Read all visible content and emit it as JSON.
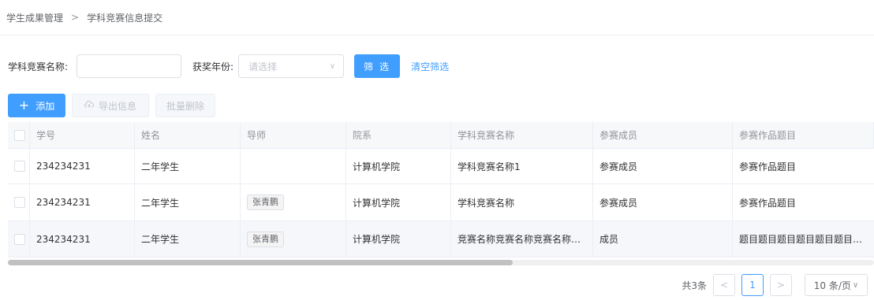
{
  "breadcrumb": {
    "root": "学生成果管理",
    "separator": ">",
    "current": "学科竞赛信息提交"
  },
  "filters": {
    "name_label": "学科竞赛名称:",
    "name_value": "",
    "year_label": "获奖年份:",
    "year_placeholder": "请选择",
    "filter_button": "筛 选",
    "clear_link": "清空筛选"
  },
  "actions": {
    "add_label": "添加",
    "export_label": "导出信息",
    "batch_delete_label": "批量删除"
  },
  "table": {
    "columns": [
      "学号",
      "姓名",
      "导师",
      "院系",
      "学科竞赛名称",
      "参赛成员",
      "参赛作品题目"
    ],
    "rows": [
      {
        "id": "234234231",
        "name": "二年学生",
        "advisor": "",
        "dept": "计算机学院",
        "competition": "学科竞赛名称1",
        "members": "参赛成员",
        "work": "参赛作品题目"
      },
      {
        "id": "234234231",
        "name": "二年学生",
        "advisor": "张青鹏",
        "dept": "计算机学院",
        "competition": "学科竞赛名称",
        "members": "参赛成员",
        "work": "参赛作品题目"
      },
      {
        "id": "234234231",
        "name": "二年学生",
        "advisor": "张青鹏",
        "dept": "计算机学院",
        "competition": "竞赛名称竞赛名称竞赛名称竞...",
        "members": "成员",
        "work": "题目题目题目题目题目题目题..."
      }
    ]
  },
  "pagination": {
    "total": "共3条",
    "current_page": "1",
    "page_size": "10 条/页"
  },
  "colors": {
    "accent": "#409eff",
    "border": "#dcdfe6",
    "header_bg": "#f7f8fa"
  }
}
